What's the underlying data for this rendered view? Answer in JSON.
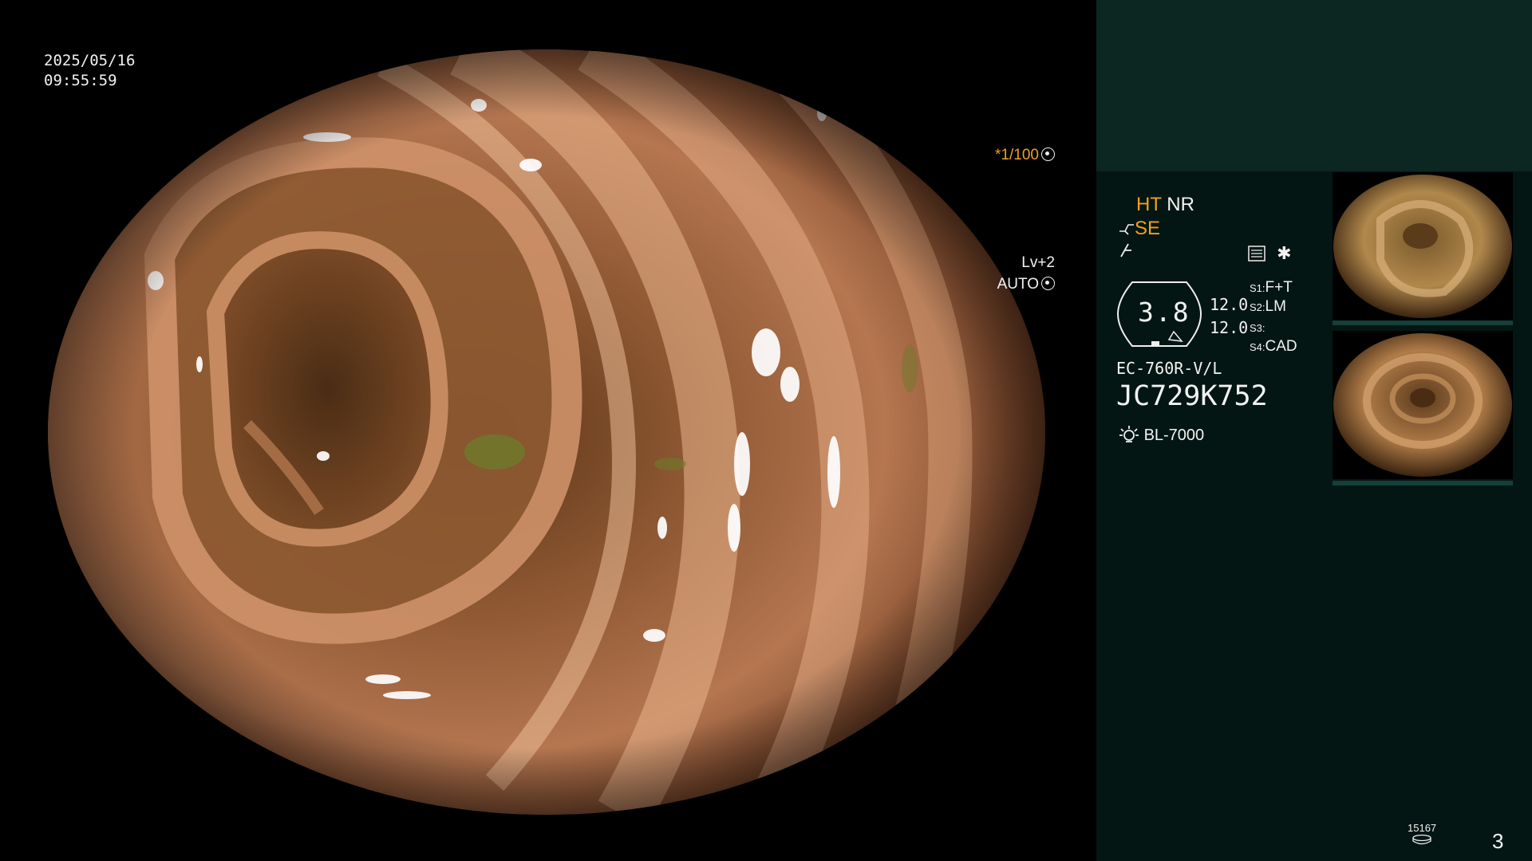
{
  "overlay": {
    "date": "2025/05/16",
    "time": "09:55:59",
    "shutter_prefix": "*",
    "shutter_value": "1/100",
    "level_label": "Lv+2",
    "auto_label": "AUTO"
  },
  "panel": {
    "ht_label": "HT",
    "nr_label": "NR",
    "se_label": "SE",
    "gauge_value": "3.8",
    "gauge_right_1": "12.0",
    "gauge_right_2": "12.0",
    "switches": [
      {
        "key": "S1:",
        "value": "F+T"
      },
      {
        "key": "S2:",
        "value": "LM"
      },
      {
        "key": "S3:",
        "value": ""
      },
      {
        "key": "S4:",
        "value": "CAD"
      }
    ],
    "scope_model": "EC-760R-V/L",
    "scope_serial": "JC729K752",
    "light_source": "BL-7000",
    "counter": "15167",
    "page_number": "3"
  },
  "icons": {
    "wb_icon": "aperture-icon",
    "auto_icon": "iris-icon",
    "scope_icon": "scope-bend-icon",
    "freeze_icon": "lightning-icon",
    "memo_icon": "list-icon",
    "star_icon": "asterisk-icon",
    "lamp_icon": "lamp-icon",
    "disk_icon": "disk-icon"
  },
  "colors": {
    "accent_orange": "#f0a020",
    "panel_bg": "#041613",
    "panel_top_bg": "#0c2622"
  }
}
